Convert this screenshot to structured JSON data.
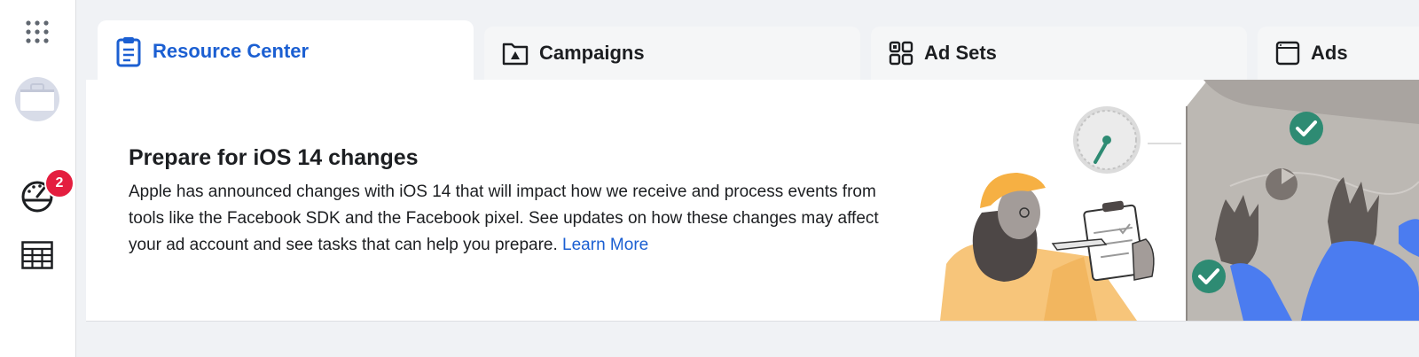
{
  "rail": {
    "apps_icon": "grid-dots-icon",
    "account_icon": "briefcase-avatar-icon",
    "dashboard_icon": "speedometer-icon",
    "notification_count": "2",
    "table_icon": "table-icon"
  },
  "tabs": [
    {
      "label": "Resource Center",
      "icon": "clipboard-icon",
      "active": true
    },
    {
      "label": "Campaigns",
      "icon": "folder-icon",
      "active": false
    },
    {
      "label": "Ad Sets",
      "icon": "grid-squares-icon",
      "active": false
    },
    {
      "label": "Ads",
      "icon": "window-icon",
      "active": false
    }
  ],
  "banner": {
    "title": "Prepare for iOS 14 changes",
    "body": "Apple has announced changes with iOS 14 that will impact how we receive and process events from tools like the Facebook SDK and the Facebook pixel. See updates on how these changes may affect your ad account and see tasks that can help you prepare.",
    "link": "Learn More"
  },
  "colors": {
    "accent": "#1b5fd2",
    "badge": "#e41e3f",
    "check_green": "#2e8b73",
    "hand_blue": "#4b7cf0"
  }
}
